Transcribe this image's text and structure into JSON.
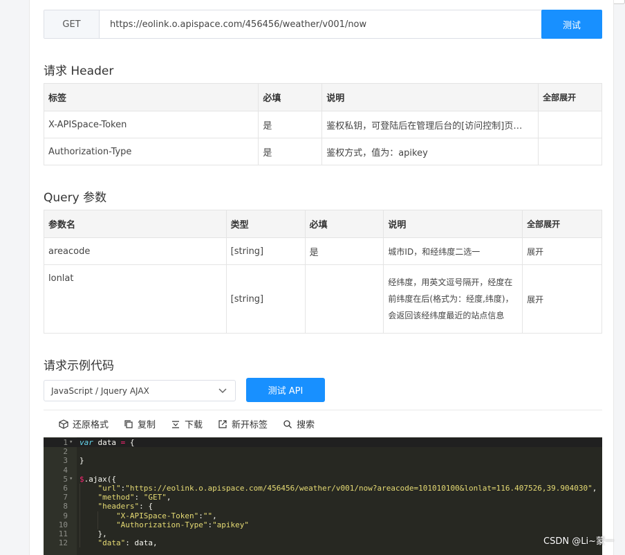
{
  "request": {
    "method": "GET",
    "url": "https://eolink.o.apispace.com/456456/weather/v001/now",
    "test_label": "测试"
  },
  "header_section": {
    "title": "请求 Header",
    "columns": [
      "标签",
      "必填",
      "说明",
      "全部展开"
    ],
    "rows": [
      {
        "name": "X-APISpace-Token",
        "required": "是",
        "desc": "鉴权私钥，可登陆后在管理后台的[访问控制]页…"
      },
      {
        "name": "Authorization-Type",
        "required": "是",
        "desc": "鉴权方式，值为：apikey"
      }
    ]
  },
  "query_section": {
    "title": "Query 参数",
    "columns": [
      "参数名",
      "类型",
      "必填",
      "说明",
      "全部展开"
    ],
    "rows": [
      {
        "name": "areacode",
        "type": "[string]",
        "required": "是",
        "desc": "城市ID，和经纬度二选一",
        "action": "展开"
      },
      {
        "name": "lonlat",
        "type": "[string]",
        "required": "",
        "desc": "经纬度，用英文逗号隔开，经度在前纬度在后(格式为：经度,纬度)，会返回该经纬度最近的站点信息",
        "action": "展开"
      }
    ]
  },
  "code_section": {
    "title": "请求示例代码",
    "language": "JavaScript / Jquery AJAX",
    "test_api_label": "测试 API",
    "toolbar": [
      "还原格式",
      "复制",
      "下载",
      "新开标签",
      "搜索"
    ]
  },
  "code_lines": [
    "var data = {",
    "",
    "}",
    "",
    "$.ajax({",
    "    \"url\":\"https://eolink.o.apispace.com/456456/weather/v001/now?areacode=101010100&lonlat=116.407526,39.904030\",",
    "    \"method\": \"GET\",",
    "    \"headers\": {",
    "        \"X-APISpace-Token\":\"\",",
    "        \"Authorization-Type\":\"apikey\"",
    "    },",
    "    \"data\": data,"
  ],
  "line_numbers": [
    "1",
    "2",
    "3",
    "4",
    "5",
    "6",
    "7",
    "8",
    "9",
    "10",
    "11",
    "12"
  ],
  "watermark": "CSDN @Li~蒙一"
}
